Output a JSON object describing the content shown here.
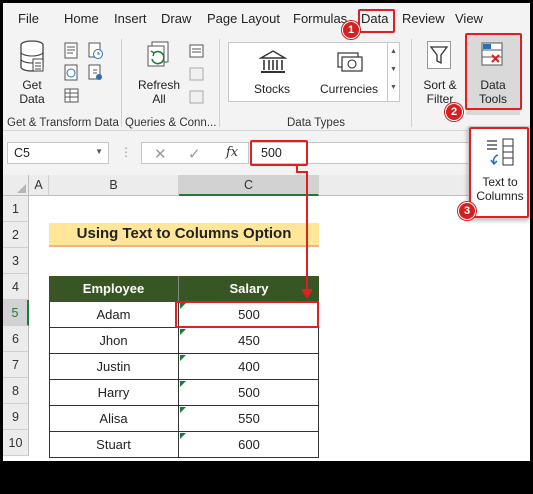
{
  "menu": [
    "File",
    "Home",
    "Insert",
    "Draw",
    "Page Layout",
    "Formulas",
    "Data",
    "Review",
    "View"
  ],
  "ribbon": {
    "get_data": "Get\nData",
    "refresh_all": "Refresh\nAll",
    "stocks": "Stocks",
    "currencies": "Currencies",
    "sort_filter": "Sort &\nFilter",
    "data_tools": "Data\nTools",
    "group_get_transform": "Get & Transform Data",
    "group_queries": "Queries & Conn...",
    "group_data_types": "Data Types"
  },
  "popup": {
    "text_to_columns": "Text to\nColumns"
  },
  "formula_bar": {
    "name_box": "C5",
    "fx": "fx",
    "value": "500"
  },
  "grid": {
    "columns": [
      "A",
      "B",
      "C"
    ],
    "rows": [
      "1",
      "2",
      "3",
      "4",
      "5",
      "6",
      "7",
      "8",
      "9",
      "10"
    ],
    "title": "Using Text to Columns Option",
    "headers": [
      "Employee",
      "Salary"
    ],
    "data": [
      [
        "Adam",
        "500"
      ],
      [
        "Jhon",
        "450"
      ],
      [
        "Justin",
        "400"
      ],
      [
        "Harry",
        "500"
      ],
      [
        "Alisa",
        "550"
      ],
      [
        "Stuart",
        "600"
      ]
    ]
  },
  "badges": [
    "1",
    "2",
    "3"
  ],
  "colors": {
    "header_green": "#375623",
    "title_fill": "#ffe699",
    "annotation_red": "#e02020"
  },
  "icons": [
    "database-icon",
    "refresh-icon",
    "stocks-bank-icon",
    "currencies-icon",
    "filter-funnel-icon",
    "data-tools-icon",
    "text-to-columns-icon",
    "cancel-x-icon",
    "enter-check-icon"
  ]
}
